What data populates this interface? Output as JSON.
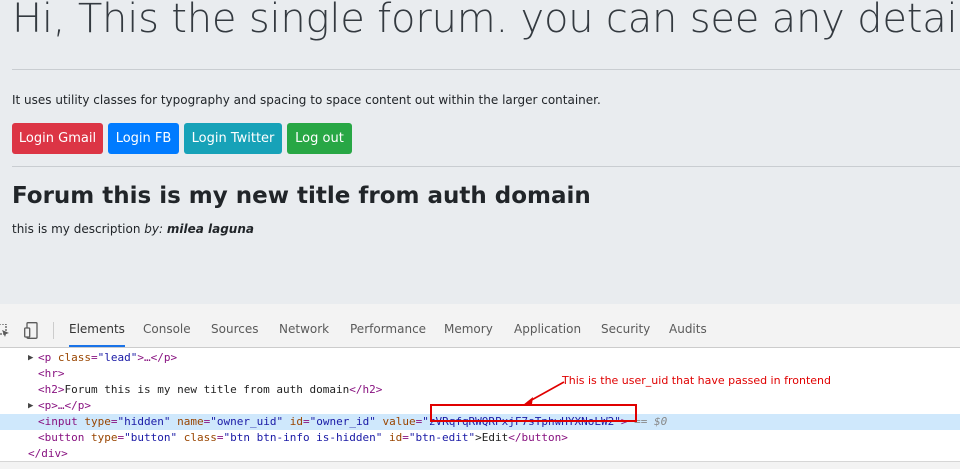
{
  "page": {
    "hero_title": "Hi, This the single forum. you can see any detail!",
    "lead": "It uses utility classes for typography and spacing to space content out within the larger container.",
    "buttons": {
      "login_gmail": "Login Gmail",
      "login_fb": "Login FB",
      "login_twitter": "Login Twitter",
      "log_out": "Log out"
    },
    "forum_title": "Forum this is my new title from auth domain",
    "description": "this is my description",
    "by_label": "by:",
    "author": "milea laguna"
  },
  "devtools": {
    "tabs": [
      "Elements",
      "Console",
      "Sources",
      "Network",
      "Performance",
      "Memory",
      "Application",
      "Security",
      "Audits"
    ],
    "active_tab": "Elements",
    "code": {
      "p_lead_tag_open": "<p",
      "p_lead_attr": "class",
      "p_lead_val": "\"lead\"",
      "p_lead_rest": ">…</p>",
      "hr": "<hr>",
      "h2_open": "<h2>",
      "h2_text": "Forum this is my new title from auth domain",
      "h2_close": "</h2>",
      "p_collapsed": "<p>…</p>",
      "input_open": "<input",
      "input_type_attr": "type",
      "input_type_val": "\"hidden\"",
      "input_name_attr": "name",
      "input_name_val": "\"owner_uid\"",
      "input_id_attr": "id",
      "input_id_val": "\"owner_id\"",
      "input_value_attr": "value",
      "input_value_val": "\"zVRqfqRWQRPxjF7sTphwHYXNoLW2\"",
      "input_close": ">",
      "console_ref": "== $0",
      "button_open": "<button",
      "button_type_attr": "type",
      "button_type_val": "\"button\"",
      "button_class_attr": "class",
      "button_class_val": "\"btn btn-info is-hidden\"",
      "button_id_attr": "id",
      "button_id_val": "\"btn-edit\"",
      "button_text": ">Edit",
      "button_close": "</button>",
      "div_close": "</div>"
    },
    "annotation": "This is the user_uid that have passed in frontend"
  },
  "colors": {
    "page_bg": "#e9ecef",
    "danger": "#dc3545",
    "primary": "#007bff",
    "info": "#17a2b8",
    "success": "#28a745",
    "annotation": "#e00000",
    "selected_row": "#cfe8fc"
  }
}
